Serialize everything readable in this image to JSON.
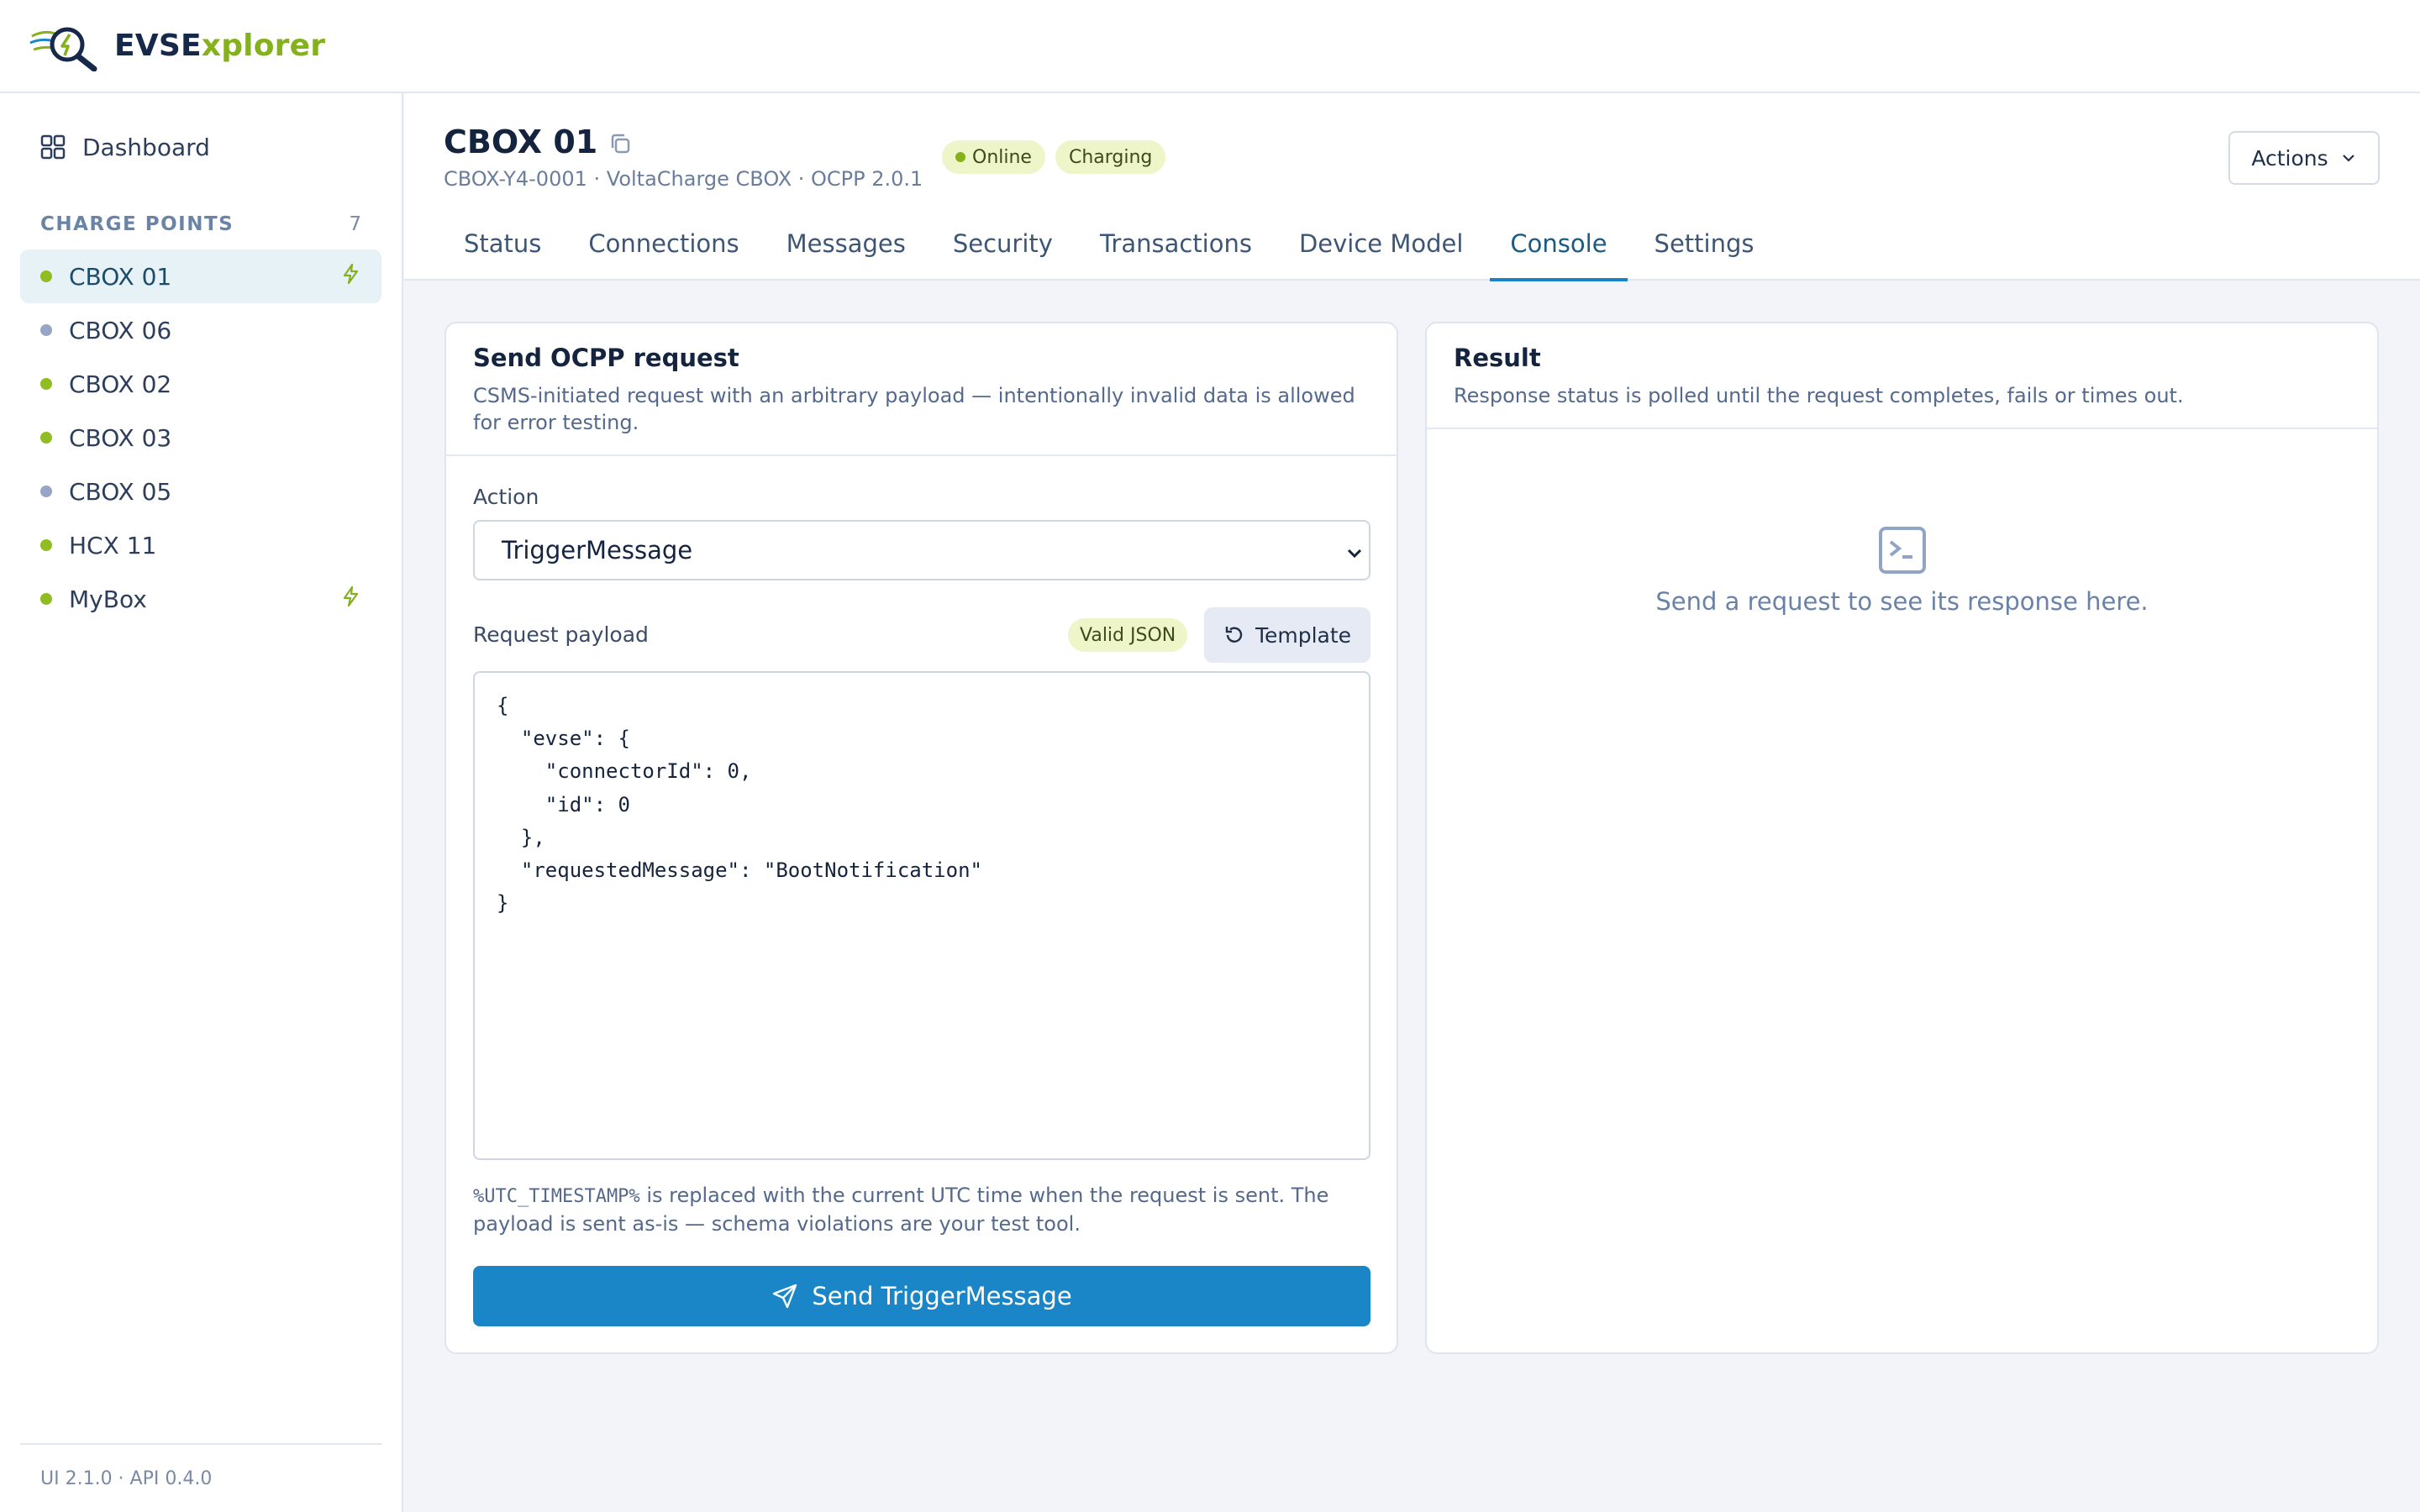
{
  "brand": {
    "part1": "EVSE",
    "part2": "xplorer"
  },
  "sidebar": {
    "dashboard_label": "Dashboard",
    "section_title": "CHARGE POINTS",
    "section_count": "7",
    "items": [
      {
        "label": "CBOX 01",
        "status_color": "#8fbd22",
        "charging": true,
        "active": true
      },
      {
        "label": "CBOX 06",
        "status_color": "#97a6c6",
        "charging": false,
        "active": false
      },
      {
        "label": "CBOX 02",
        "status_color": "#8fbd22",
        "charging": false,
        "active": false
      },
      {
        "label": "CBOX 03",
        "status_color": "#8fbd22",
        "charging": false,
        "active": false
      },
      {
        "label": "CBOX 05",
        "status_color": "#97a6c6",
        "charging": false,
        "active": false
      },
      {
        "label": "HCX 11",
        "status_color": "#8fbd22",
        "charging": false,
        "active": false
      },
      {
        "label": "MyBox",
        "status_color": "#8fbd22",
        "charging": true,
        "active": false
      }
    ],
    "footer": "UI 2.1.0 · API 0.4.0"
  },
  "header": {
    "title": "CBOX 01",
    "subtitle": "CBOX-Y4-0001 · VoltaCharge CBOX · OCPP 2.0.1",
    "badge_online": "Online",
    "badge_charging": "Charging",
    "actions_label": "Actions",
    "tabs": [
      "Status",
      "Connections",
      "Messages",
      "Security",
      "Transactions",
      "Device Model",
      "Console",
      "Settings"
    ],
    "active_tab": "Console"
  },
  "request": {
    "title": "Send OCPP request",
    "description": "CSMS-initiated request with an arbitrary payload — intentionally invalid data is allowed for error testing.",
    "action_label": "Action",
    "action_value": "TriggerMessage",
    "payload_label": "Request payload",
    "valid_badge": "Valid JSON",
    "template_label": "Template",
    "payload": "{\n  \"evse\": {\n    \"connectorId\": 0,\n    \"id\": 0\n  },\n  \"requestedMessage\": \"BootNotification\"\n}",
    "hint_code": "%UTC_TIMESTAMP%",
    "hint_text": " is replaced with the current UTC time when the request is sent. The payload is sent as-is — schema violations are your test tool.",
    "send_label": "Send TriggerMessage"
  },
  "result": {
    "title": "Result",
    "description": "Response status is polled until the request completes, fails or times out.",
    "empty_text": "Send a request to see its response here."
  },
  "colors": {
    "accent": "#1b86c7",
    "brand_green": "#84b11c",
    "navy": "#17294a"
  }
}
